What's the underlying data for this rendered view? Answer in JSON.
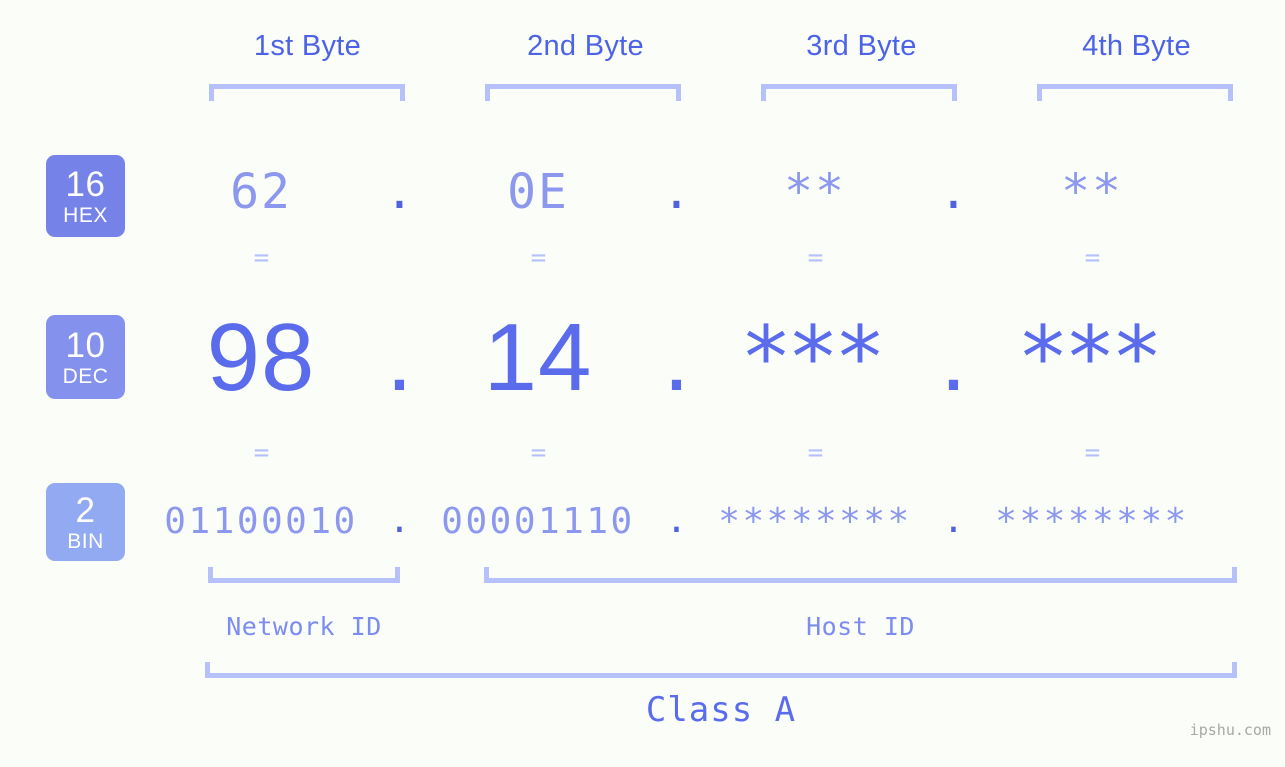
{
  "background_color": "#fbfdf8",
  "accent_colors": {
    "bracket": "#b6c1fb",
    "heading": "#4c63e6",
    "value_light": "#8b98ee",
    "value_strong": "#5a6ceb",
    "badge_hex": "#7583e8",
    "badge_dec": "#8492ed",
    "badge_bin": "#92aaf2",
    "watermark": "#a8a8a8"
  },
  "byte_headers": [
    {
      "label": "1st Byte"
    },
    {
      "label": "2nd Byte"
    },
    {
      "label": "3rd Byte"
    },
    {
      "label": "4th Byte"
    }
  ],
  "bases": [
    {
      "id": "hex",
      "number": "16",
      "name": "HEX"
    },
    {
      "id": "dec",
      "number": "10",
      "name": "DEC"
    },
    {
      "id": "bin",
      "number": "2",
      "name": "BIN"
    }
  ],
  "rows": {
    "hex": {
      "values": [
        "62",
        "0E",
        "**",
        "**"
      ],
      "separator": "."
    },
    "dec": {
      "values": [
        "98",
        "14",
        "***",
        "***"
      ],
      "separator": "."
    },
    "bin": {
      "values": [
        "01100010",
        "00001110",
        "********",
        "********"
      ],
      "separator": "."
    }
  },
  "connectors": {
    "symbol": "=",
    "count": 4
  },
  "segments": {
    "network_id": "Network ID",
    "host_id": "Host ID"
  },
  "class": {
    "label": "Class A"
  },
  "watermark": "ipshu.com"
}
